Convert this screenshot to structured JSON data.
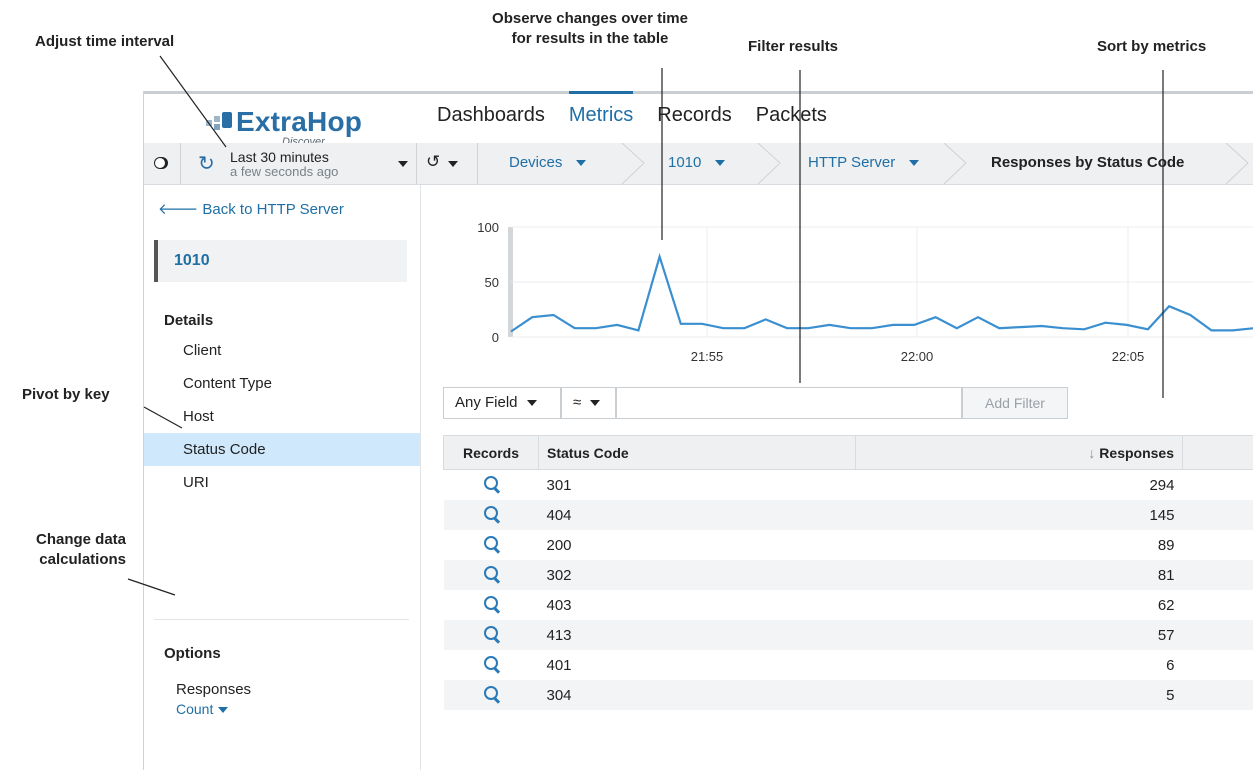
{
  "annotations": {
    "adjust_time": "Adjust time interval",
    "observe_line1": "Observe changes over time",
    "observe_line2": "for results in the table",
    "filter": "Filter results",
    "sort": "Sort by metrics",
    "pivot": "Pivot by key",
    "change_line1": "Change data",
    "change_line2": "calculations"
  },
  "app": {
    "logo_text": "ExtraHop",
    "logo_sub": "Discover",
    "nav": [
      "Dashboards",
      "Metrics",
      "Records",
      "Packets"
    ],
    "nav_active_index": 1,
    "time_range": "Last 30 minutes",
    "time_updated": "a few seconds ago",
    "breadcrumbs": [
      "Devices",
      "1010",
      "HTTP Server",
      "Responses by Status Code"
    ]
  },
  "sidebar": {
    "back": "Back to HTTP Server",
    "device": "1010",
    "details_title": "Details",
    "details_items": [
      "Client",
      "Content Type",
      "Host",
      "Status Code",
      "URI"
    ],
    "active_item": "Status Code",
    "options_title": "Options",
    "metric": "Responses",
    "calc": "Count"
  },
  "filter": {
    "field": "Any Field",
    "operator": "≈",
    "value": "",
    "button": "Add Filter"
  },
  "table": {
    "headers": [
      "Records",
      "Status Code",
      "Responses"
    ],
    "sort_indicator": "↓",
    "rows": [
      {
        "code": "301",
        "responses": "294"
      },
      {
        "code": "404",
        "responses": "145"
      },
      {
        "code": "200",
        "responses": "89"
      },
      {
        "code": "302",
        "responses": "81"
      },
      {
        "code": "403",
        "responses": "62"
      },
      {
        "code": "413",
        "responses": "57"
      },
      {
        "code": "401",
        "responses": "6"
      },
      {
        "code": "304",
        "responses": "5"
      }
    ]
  },
  "colors": {
    "accent": "#1f6fa6",
    "line": "#3a8fd0",
    "selected": "#cfe8fb"
  },
  "chart_data": {
    "type": "line",
    "ylim": [
      0,
      100
    ],
    "yticks": [
      0,
      50,
      100
    ],
    "xticks": [
      "21:55",
      "22:00",
      "22:05"
    ],
    "series": [
      {
        "values": [
          5,
          18,
          20,
          8,
          8,
          11,
          6,
          73,
          12,
          12,
          8,
          8,
          16,
          8,
          8,
          11,
          8,
          8,
          11,
          11,
          18,
          8,
          18,
          8,
          9,
          10,
          8,
          7,
          13,
          11,
          7,
          28,
          20,
          6,
          6,
          8
        ]
      }
    ]
  }
}
